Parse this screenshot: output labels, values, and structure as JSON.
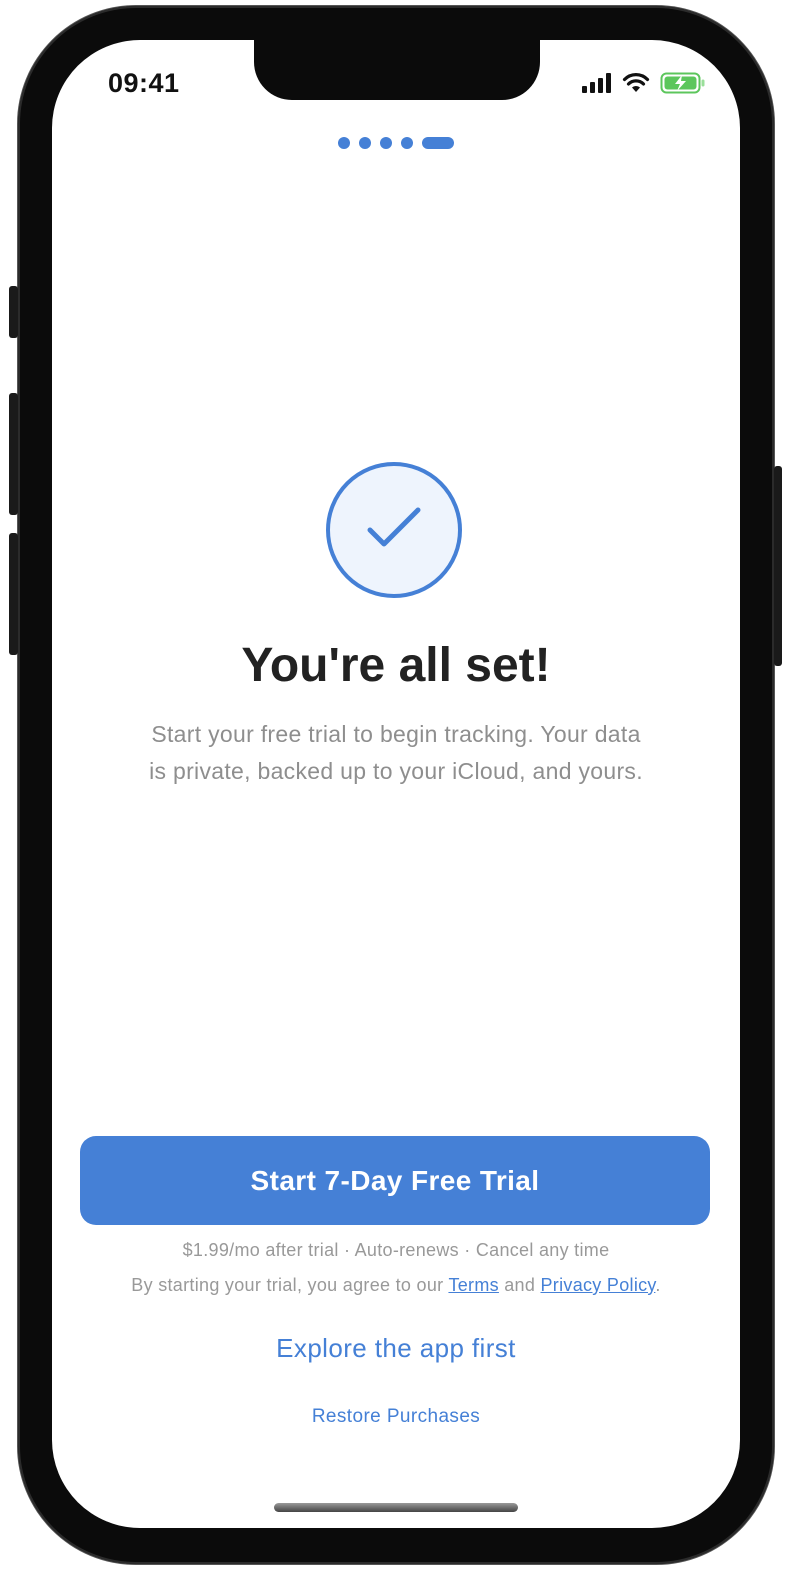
{
  "status_bar": {
    "time": "09:41",
    "icons": [
      "cellular-signal-icon",
      "wifi-icon",
      "battery-charging-icon"
    ],
    "battery_color": "#5cc65c"
  },
  "pager": {
    "total": 5,
    "active_index": 4
  },
  "hero": {
    "icon": "checkmark-icon",
    "title": "You're all set!",
    "subtitle": "Start your free trial to begin tracking. Your data is private, backed up to your iCloud, and yours."
  },
  "cta": {
    "label": "Start 7-Day Free Trial"
  },
  "pricing_note": "$1.99/mo after trial · Auto-renews · Cancel any time",
  "legal": {
    "prefix": "By starting your trial, you agree to our",
    "terms": "Terms",
    "conjunction": "and",
    "privacy": "Privacy Policy",
    "suffix": "."
  },
  "explore_label": "Explore the app first",
  "restore_label": "Restore Purchases",
  "colors": {
    "accent": "#4580d6",
    "title": "#222222",
    "muted": "#8e8e8e"
  }
}
